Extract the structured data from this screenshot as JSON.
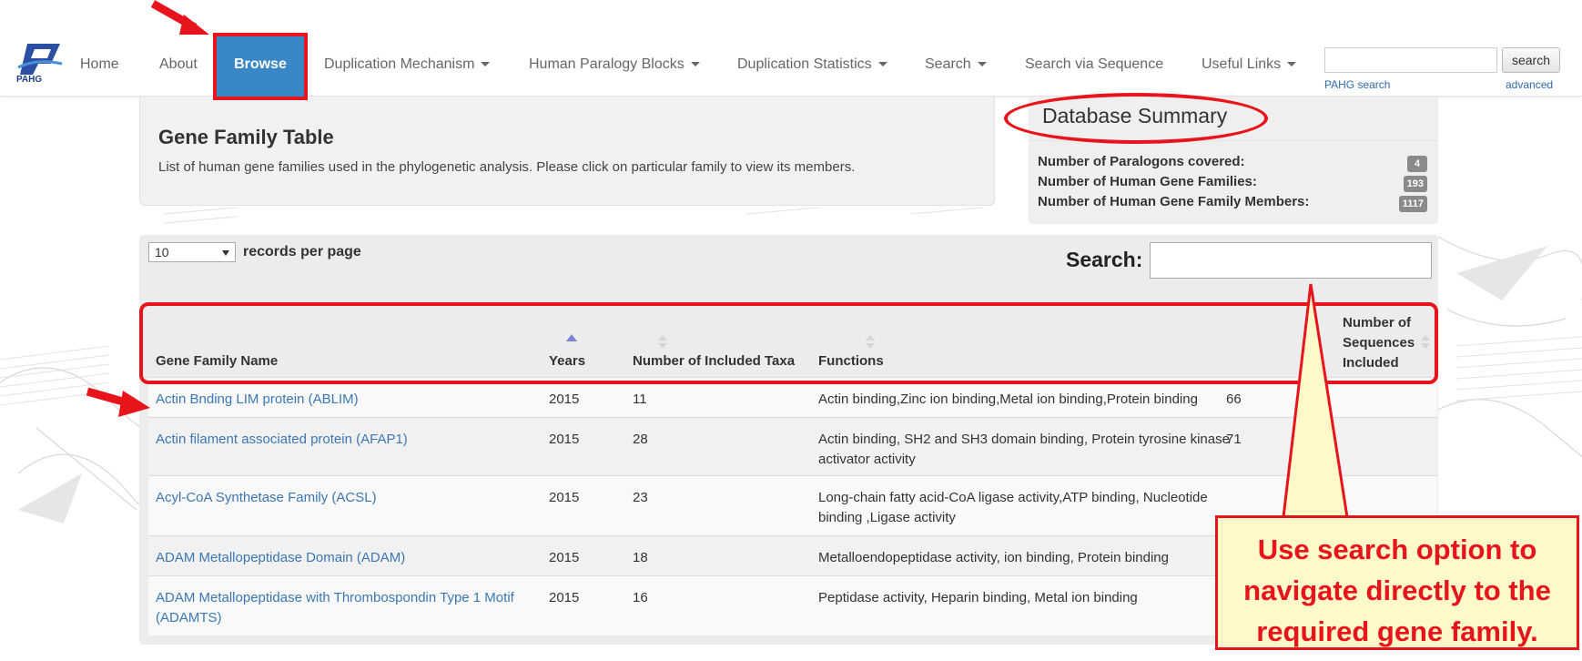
{
  "nav": {
    "brand": "PAHG",
    "items": [
      {
        "label": "Home",
        "dropdown": false
      },
      {
        "label": "About",
        "dropdown": false
      },
      {
        "label": "Browse",
        "dropdown": false,
        "active": true
      },
      {
        "label": "Duplication Mechanism",
        "dropdown": true
      },
      {
        "label": "Human Paralogy Blocks",
        "dropdown": true
      },
      {
        "label": "Duplication Statistics",
        "dropdown": true
      },
      {
        "label": "Search",
        "dropdown": true
      },
      {
        "label": "Search via Sequence",
        "dropdown": false
      },
      {
        "label": "Useful Links",
        "dropdown": true
      }
    ],
    "search_button": "search",
    "search_value": "",
    "pahg_search_link": "PAHG search",
    "advanced_link": "advanced"
  },
  "header": {
    "title": "Gene Family Table",
    "subtitle": "List of human gene families used in the phylogenetic analysis. Please click on particular family to view its members."
  },
  "summary": {
    "title": "Database Summary",
    "rows": [
      {
        "label": "Number of Paralogons covered:",
        "value": "4"
      },
      {
        "label": "Number of Human Gene Families:",
        "value": "193"
      },
      {
        "label": "Number of Human Gene Family Members:",
        "value": "1117"
      }
    ]
  },
  "table": {
    "page_length": "10",
    "page_length_label": "records per page",
    "search_label": "Search:",
    "search_value": "",
    "columns": [
      "Gene Family Name",
      "Years",
      "Number of Included Taxa",
      "Functions",
      "Number of Sequences Included"
    ],
    "sorted_column": "Gene Family Name",
    "rows": [
      {
        "name": "Actin Bnding LIM protein (ABLIM)",
        "year": "2015",
        "taxa": "11",
        "functions": "Actin binding,Zinc ion binding,Metal ion binding,Protein binding",
        "sequences": "66"
      },
      {
        "name": "Actin filament associated protein (AFAP1)",
        "year": "2015",
        "taxa": "28",
        "functions": "Actin binding, SH2 and SH3 domain binding, Protein tyrosine kinase activator activity",
        "sequences": "71"
      },
      {
        "name": "Acyl-CoA Synthetase Family (ACSL)",
        "year": "2015",
        "taxa": "23",
        "functions": "Long-chain fatty acid-CoA ligase activity,ATP binding, Nucleotide binding ,Ligase activity",
        "sequences": ""
      },
      {
        "name": "ADAM Metallopeptidase Domain (ADAM)",
        "year": "2015",
        "taxa": "18",
        "functions": "Metalloendopeptidase activity, ion binding, Protein binding",
        "sequences": ""
      },
      {
        "name": "ADAM Metallopeptidase with Thrombospondin Type 1 Motif (ADAMTS)",
        "year": "2015",
        "taxa": "16",
        "functions": "Peptidase activity, Heparin binding, Metal ion binding",
        "sequences": ""
      }
    ]
  },
  "callout": {
    "text": "Use search option to\nnavigate directly to the\nrequired gene family."
  },
  "colors": {
    "nav_active": "#3a87c8",
    "link": "#3b77b5",
    "annotation_red": "#e8141c",
    "callout_fill": "#fff8c8"
  }
}
